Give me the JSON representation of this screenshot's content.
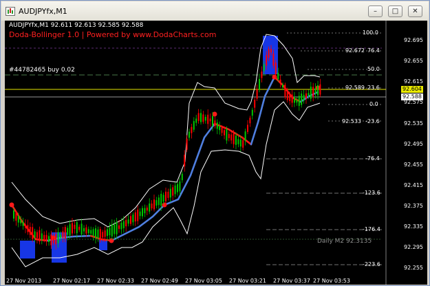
{
  "window": {
    "title": "AUDJPYfx,M1",
    "buttons": {
      "minimize": "–",
      "maximize": "□",
      "close": "✕"
    }
  },
  "chart": {
    "ohlc_header": "AUDJPYfx,M1  92.611 92.613 92.585 92.588",
    "indicator_label": "Doda-Bollinger 1.0 | Powered by www.DodaCharts.com",
    "order_label": "#44782465 buy 0.02",
    "level_labels": [
      {
        "pct": "100.0",
        "price": ""
      },
      {
        "pct": "76.4",
        "price": "92.672"
      },
      {
        "pct": "50.0",
        "price": ""
      },
      {
        "pct": "23.6",
        "price": "92.589"
      },
      {
        "pct": "0.0",
        "price": ""
      },
      {
        "pct": "-23.6",
        "price": "92.533"
      },
      {
        "pct": "-76.4",
        "price": ""
      },
      {
        "pct": "-123.6",
        "price": ""
      },
      {
        "pct": "-176.4",
        "price": ""
      },
      {
        "pct": "-223.6",
        "price": ""
      }
    ],
    "daily_label": "Daily M2 92.3135",
    "price_axis": [
      "92.695",
      "92.655",
      "92.615",
      "92.575",
      "92.535",
      "92.495",
      "92.455",
      "92.415",
      "92.375",
      "92.335",
      "92.295",
      "92.255"
    ],
    "bid_tag": "92.604",
    "order_tag": "92.588",
    "time_axis": [
      "27 Nov 2013",
      "27 Nov 02:17",
      "27 Nov 02:33",
      "27 Nov 02:49",
      "27 Nov 03:05",
      "27 Nov 03:21",
      "27 Nov 03:37",
      "27 Nov 03:53"
    ],
    "colors": {
      "background": "#000000",
      "bull_candle": "#00c800",
      "bear_candle": "#ff0000",
      "bands": "#ffffff",
      "mid_up": "#4f7fe0",
      "mid_down": "#ff1a1a",
      "bid_line": "#e8e800",
      "highlight": "#1a3cff"
    }
  }
}
